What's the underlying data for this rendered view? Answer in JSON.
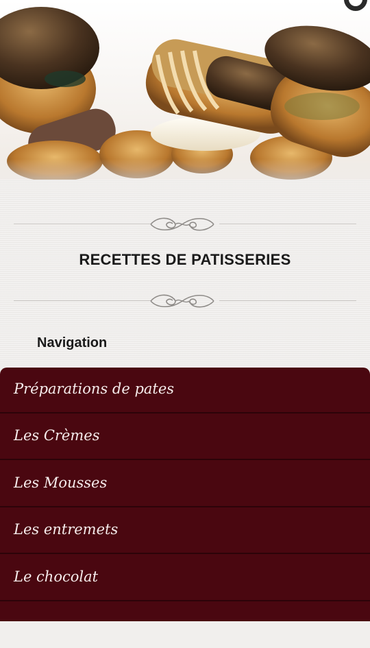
{
  "header": {
    "title": "RECETTES DE PATISSERIES"
  },
  "navigation": {
    "heading": "Navigation",
    "items": [
      {
        "label": "Préparations de pates"
      },
      {
        "label": "Les Crèmes"
      },
      {
        "label": "Les Mousses"
      },
      {
        "label": "Les entremets"
      },
      {
        "label": "Le chocolat"
      },
      {
        "label": ""
      }
    ]
  },
  "colors": {
    "menu_background": "#4a0710",
    "menu_divider": "#2c0309",
    "paper": "#efedeb"
  },
  "icons": {
    "status": "status-icon",
    "ornament": "flourish-ornament-icon"
  }
}
